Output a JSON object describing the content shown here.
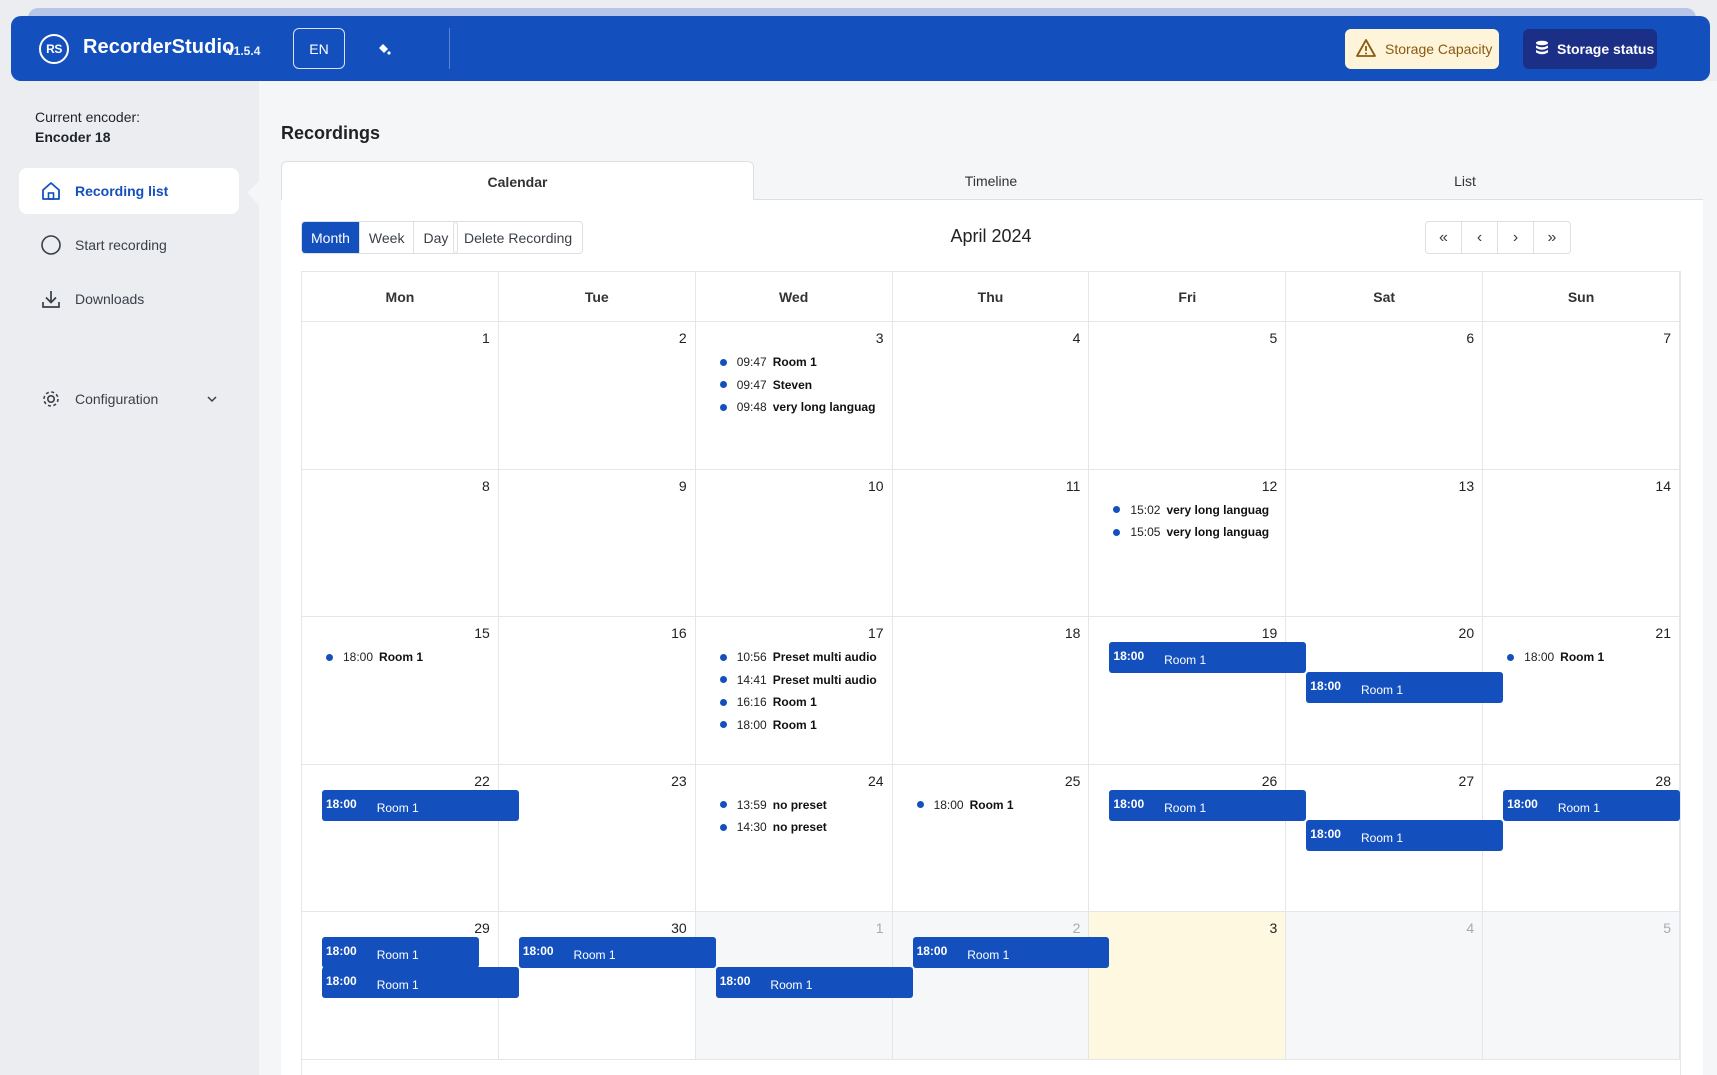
{
  "app": {
    "logo_text": "RS",
    "name": "RecorderStudio",
    "version": "v1.5.4",
    "language": "EN",
    "storage_capacity_label": "Storage Capacity",
    "storage_status_label": "Storage status"
  },
  "sidebar": {
    "encoder_label": "Current encoder:",
    "encoder_value": "Encoder 18",
    "items": [
      {
        "label": "Recording list",
        "icon": "home-icon",
        "active": true
      },
      {
        "label": "Start recording",
        "icon": "record-circle-icon"
      },
      {
        "label": "Downloads",
        "icon": "download-icon"
      },
      {
        "label": "Configuration",
        "icon": "gear-icon"
      }
    ]
  },
  "main": {
    "title": "Recordings",
    "tabs": [
      "Calendar",
      "Timeline",
      "List"
    ],
    "views": [
      "Month",
      "Week",
      "Day"
    ],
    "delete_label": "Delete Recording",
    "month_title": "April 2024",
    "nav": [
      "«",
      "‹",
      "›",
      "»"
    ],
    "weekdays": [
      "Mon",
      "Tue",
      "Wed",
      "Thu",
      "Fri",
      "Sat",
      "Sun"
    ],
    "weeks": [
      [
        "1",
        "2",
        "3",
        "4",
        "5",
        "6",
        "7"
      ],
      [
        "8",
        "9",
        "10",
        "11",
        "12",
        "13",
        "14"
      ],
      [
        "15",
        "16",
        "17",
        "18",
        "19",
        "20",
        "21"
      ],
      [
        "22",
        "23",
        "24",
        "25",
        "26",
        "27",
        "28"
      ],
      [
        "29",
        "30",
        "1",
        "2",
        "3",
        "4",
        "5"
      ]
    ],
    "events": [
      {
        "week": 0,
        "day": 2,
        "items": [
          {
            "time": "09:47",
            "title": "Room 1"
          },
          {
            "time": "09:47",
            "title": "Steven"
          },
          {
            "time": "09:48",
            "title": "very long languag"
          }
        ]
      },
      {
        "week": 1,
        "day": 4,
        "items": [
          {
            "time": "15:02",
            "title": "very long languag"
          },
          {
            "time": "15:05",
            "title": "very long languag"
          }
        ]
      },
      {
        "week": 2,
        "day": 0,
        "items": [
          {
            "time": "18:00",
            "title": "Room 1"
          }
        ]
      },
      {
        "week": 2,
        "day": 2,
        "items": [
          {
            "time": "10:56",
            "title": "Preset multi audio"
          },
          {
            "time": "14:41",
            "title": "Preset multi audio"
          },
          {
            "time": "16:16",
            "title": "Room 1"
          },
          {
            "time": "18:00",
            "title": "Room 1"
          }
        ]
      },
      {
        "week": 2,
        "day": 6,
        "items": [
          {
            "time": "18:00",
            "title": "Room 1"
          }
        ]
      },
      {
        "week": 3,
        "day": 2,
        "items": [
          {
            "time": "13:59",
            "title": "no preset"
          },
          {
            "time": "14:30",
            "title": "no preset"
          }
        ]
      },
      {
        "week": 3,
        "day": 3,
        "items": [
          {
            "time": "18:00",
            "title": "Room 1"
          }
        ]
      }
    ],
    "spans": [
      {
        "week": 2,
        "start": 4,
        "end": 5,
        "lane": 0,
        "time": "18:00",
        "title": "Room 1"
      },
      {
        "week": 2,
        "start": 5,
        "end": 6,
        "lane": 1,
        "time": "18:00",
        "title": "Room 1"
      },
      {
        "week": 3,
        "start": 0,
        "end": 1,
        "lane": 0,
        "time": "18:00",
        "title": "Room 1"
      },
      {
        "week": 3,
        "start": 4,
        "end": 5,
        "lane": 0,
        "time": "18:00",
        "title": "Room 1"
      },
      {
        "week": 3,
        "start": 5,
        "end": 6,
        "lane": 1,
        "time": "18:00",
        "title": "Room 1"
      },
      {
        "week": 3,
        "start": 6,
        "end": 6.9,
        "lane": 0,
        "time": "18:00",
        "title": "Room 1"
      },
      {
        "week": 4,
        "start": 0,
        "end": 0.8,
        "lane": 0,
        "time": "18:00",
        "title": "Room 1"
      },
      {
        "week": 4,
        "start": 1,
        "end": 2,
        "lane": 0,
        "time": "18:00",
        "title": "Room 1"
      },
      {
        "week": 4,
        "start": 0,
        "end": 1,
        "lane": 1,
        "time": "18:00",
        "title": "Room 1"
      },
      {
        "week": 4,
        "start": 2,
        "end": 3,
        "lane": 1,
        "time": "18:00",
        "title": "Room 1"
      },
      {
        "week": 4,
        "start": 3,
        "end": 4,
        "lane": 0,
        "time": "18:00",
        "title": "Room 1"
      }
    ],
    "colors": {
      "accent": "#1450bd",
      "today": "#fef8e0"
    }
  }
}
